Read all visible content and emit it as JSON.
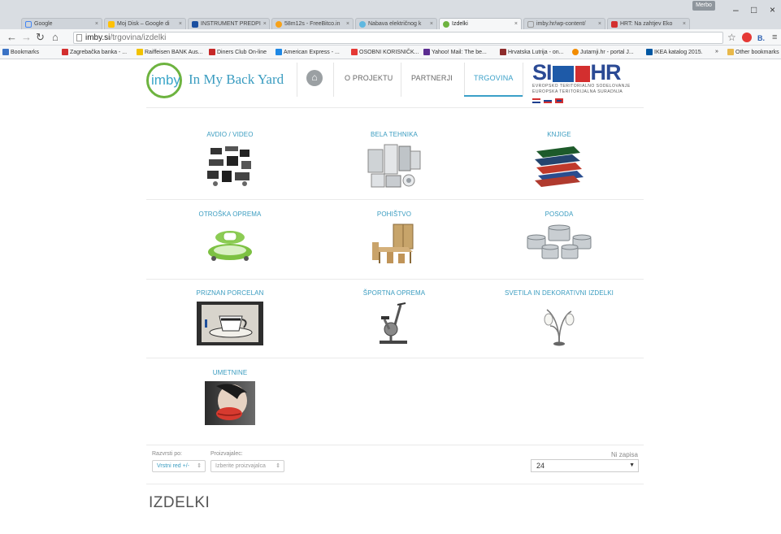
{
  "browser": {
    "tabs": [
      {
        "title": "Google",
        "color": "#ffffff"
      },
      {
        "title": "Moj Disk – Google di",
        "color": "#ffc107"
      },
      {
        "title": "INSTRUMENT PREDPI",
        "color": "#1a4fa0"
      },
      {
        "title": "58m12s - FreeBitco.in",
        "color": "#f7a21a"
      },
      {
        "title": "Nabava električnog k",
        "color": "#5fb8e0"
      },
      {
        "title": "Izdelki",
        "color": "#6db33f"
      },
      {
        "title": "imby.hr/wp-content/",
        "color": "#ffffff"
      },
      {
        "title": "HRT: Na zahtjev Eko",
        "color": "#d32f2f"
      }
    ],
    "profile": "Merbo",
    "url_host": "imby.si",
    "url_path": "/trgovina/izdelki",
    "bookmarks": [
      {
        "label": "Bookmarks",
        "color": "#3b73c5"
      },
      {
        "label": "Zagrebačka banka - ...",
        "color": "#d32f2f"
      },
      {
        "label": "Raiffeisen BANK Aus...",
        "color": "#f2c200"
      },
      {
        "label": "Diners Club On-line",
        "color": "#c62828"
      },
      {
        "label": "American Express - ...",
        "color": "#1e88e5"
      },
      {
        "label": "OSOBNI KORISNIČK...",
        "color": "#e53935"
      },
      {
        "label": "Yahoo! Mail: The be...",
        "color": "#5c2d91"
      },
      {
        "label": "Hrvatska Lutrija - on...",
        "color": "#8d2b2b"
      },
      {
        "label": "Jutarnji.hr - portal J...",
        "color": "#f28c00"
      },
      {
        "label": "IKEA katalog 2015.",
        "color": "#0058a3"
      },
      {
        "label": "»",
        "color": "#f6f7f8"
      },
      {
        "label": "Other bookmarks",
        "color": "#e8b84a"
      }
    ]
  },
  "site": {
    "logo_word": "imby",
    "logo_text": "In My Back Yard",
    "menu": [
      "O PROJEKTU",
      "PARTNERJI",
      "TRGOVINA"
    ],
    "partner_logo": {
      "big_left": "SI",
      "big_right": "HR",
      "line1": "EVROPSKO TERITORIALNO SODELOVANJE",
      "line2": "EUROPSKA TERITORIJALNA SURADNJA"
    }
  },
  "categories": [
    {
      "label": "AVDIO / VIDEO",
      "icon": "audio-video-image"
    },
    {
      "label": "BELA TEHNIKA",
      "icon": "appliances-image"
    },
    {
      "label": "KNJIGE",
      "icon": "books-image"
    },
    {
      "label": "OTROŠKA OPREMA",
      "icon": "baby-walker-image"
    },
    {
      "label": "POHIŠTVO",
      "icon": "furniture-image"
    },
    {
      "label": "POSODA",
      "icon": "cookware-image"
    },
    {
      "label": "PRIZNAN PORCELAN",
      "icon": "porcelain-cup-image"
    },
    {
      "label": "ŠPORTNA OPREMA",
      "icon": "exercise-bike-image"
    },
    {
      "label": "SVETILA IN DEKORATIVNI IZDELKI",
      "icon": "lamp-image"
    },
    {
      "label": "UMETNINE",
      "icon": "artwork-image"
    }
  ],
  "controls": {
    "sort_label": "Razvrsti po:",
    "sort_value": "Vrstni red +/-",
    "maker_label": "Proizvajalec:",
    "maker_value": "Izberite proizvajalca",
    "count_label": "Ni zapisa",
    "count_value": "24"
  },
  "heading": "IZDELKI"
}
